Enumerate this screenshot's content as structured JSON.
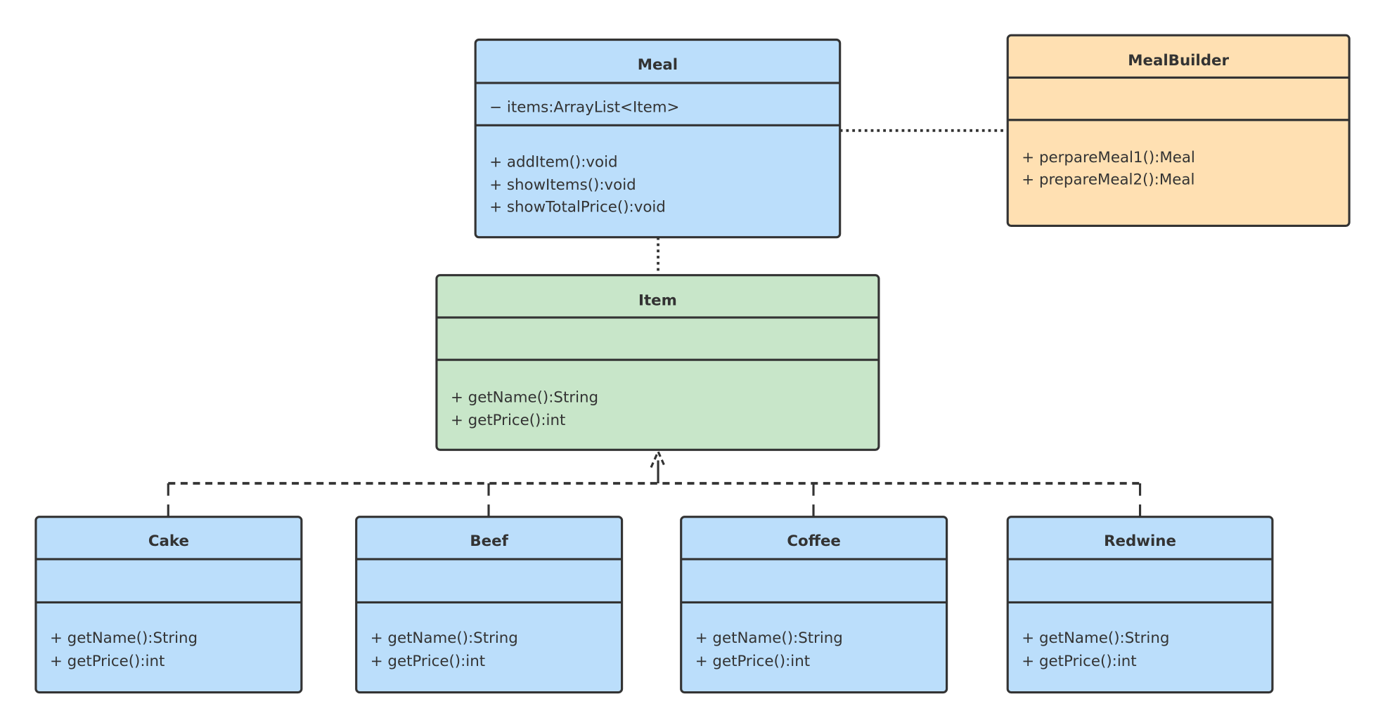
{
  "colors": {
    "blue": "#bbdefb",
    "green": "#c8e6c9",
    "orange": "#ffe0b2",
    "stroke": "#333333"
  },
  "classes": [
    {
      "id": "meal",
      "name": "Meal",
      "attributes": [
        "− items:ArrayList<Item>"
      ],
      "methods": [
        "+ addItem():void",
        "+ showItems():void",
        "+ showTotalPrice():void"
      ],
      "color": "#bbdefb"
    },
    {
      "id": "mealbuilder",
      "name": "MealBuilder",
      "attributes": [],
      "methods": [
        "+ perpareMeal1():Meal",
        "+ prepareMeal2():Meal"
      ],
      "color": "#ffe0b2"
    },
    {
      "id": "item",
      "name": "Item",
      "attributes": [],
      "methods": [
        "+ getName():String",
        "+ getPrice():int"
      ],
      "color": "#c8e6c9"
    },
    {
      "id": "cake",
      "name": "Cake",
      "attributes": [],
      "methods": [
        "+ getName():String",
        "+ getPrice():int"
      ],
      "color": "#bbdefb"
    },
    {
      "id": "beef",
      "name": "Beef",
      "attributes": [],
      "methods": [
        "+ getName():String",
        "+ getPrice():int"
      ],
      "color": "#bbdefb"
    },
    {
      "id": "coffee",
      "name": "Coffee",
      "attributes": [],
      "methods": [
        "+ getName():String",
        "+ getPrice():int"
      ],
      "color": "#bbdefb"
    },
    {
      "id": "redwine",
      "name": "Redwine",
      "attributes": [],
      "methods": [
        "+ getName():String",
        "+ getPrice():int"
      ],
      "color": "#bbdefb"
    }
  ],
  "relations": [
    {
      "from": "mealbuilder",
      "to": "meal",
      "type": "dependency"
    },
    {
      "from": "meal",
      "to": "item",
      "type": "dependency"
    },
    {
      "from": "cake",
      "to": "item",
      "type": "realization"
    },
    {
      "from": "beef",
      "to": "item",
      "type": "realization"
    },
    {
      "from": "coffee",
      "to": "item",
      "type": "realization"
    },
    {
      "from": "redwine",
      "to": "item",
      "type": "realization"
    }
  ]
}
